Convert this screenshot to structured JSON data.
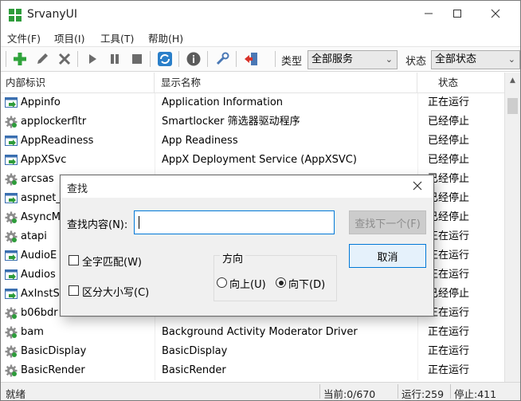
{
  "window": {
    "title": "SrvanyUI"
  },
  "menu": [
    "文件(F)",
    "项目(I)",
    "工具(T)",
    "帮助(H)"
  ],
  "toolbar": {
    "buttons": [
      "add-icon",
      "edit-icon",
      "delete-icon",
      "start-icon",
      "pause-icon",
      "stop-icon",
      "refresh-icon",
      "info-icon",
      "wrench-icon",
      "exit-icon"
    ],
    "type_label": "类型",
    "type_value": "全部服务",
    "status_label": "状态",
    "status_value": "全部状态"
  },
  "table": {
    "columns": [
      "内部标识",
      "显示名称",
      "状态"
    ],
    "rows": [
      {
        "id": "Appinfo",
        "name": "Application Information",
        "status": "正在运行",
        "icon": "window-icon"
      },
      {
        "id": "applockerfltr",
        "name": "Smartlocker 筛选器驱动程序",
        "status": "已经停止",
        "icon": "gear-icon"
      },
      {
        "id": "AppReadiness",
        "name": "App Readiness",
        "status": "已经停止",
        "icon": "window-icon"
      },
      {
        "id": "AppXSvc",
        "name": "AppX Deployment Service (AppXSVC)",
        "status": "已经停止",
        "icon": "window-icon"
      },
      {
        "id": "arcsas",
        "name": "",
        "status": "已经停止",
        "icon": "gear-icon"
      },
      {
        "id": "aspnet_",
        "name": "",
        "status": "已经停止",
        "icon": "window-icon"
      },
      {
        "id": "AsyncM",
        "name": "",
        "status": "已经停止",
        "icon": "gear-icon"
      },
      {
        "id": "atapi",
        "name": "",
        "status": "正在运行",
        "icon": "gear-icon"
      },
      {
        "id": "AudioE",
        "name": "",
        "status": "正在运行",
        "icon": "window-icon"
      },
      {
        "id": "Audios",
        "name": "",
        "status": "正在运行",
        "icon": "window-icon"
      },
      {
        "id": "AxInstS",
        "name": "",
        "status": "已经停止",
        "icon": "window-icon"
      },
      {
        "id": "b06bdr",
        "name": "",
        "status": "正在运行",
        "icon": "gear-icon"
      },
      {
        "id": "bam",
        "name": "Background Activity Moderator Driver",
        "status": "正在运行",
        "icon": "gear-icon"
      },
      {
        "id": "BasicDisplay",
        "name": "BasicDisplay",
        "status": "正在运行",
        "icon": "gear-icon"
      },
      {
        "id": "BasicRender",
        "name": "BasicRender",
        "status": "正在运行",
        "icon": "gear-icon"
      }
    ]
  },
  "statusbar": {
    "ready": "就绪",
    "current": "当前:0/670",
    "running": "运行:259",
    "stopped": "停止:411"
  },
  "find_dialog": {
    "title": "查找",
    "find_label": "查找内容(N):",
    "find_value": "",
    "find_next": "查找下一个(F)",
    "cancel": "取消",
    "whole_word": "全字匹配(W)",
    "match_case": "区分大小写(C)",
    "direction_label": "方向",
    "up": "向上(U)",
    "down": "向下(D)",
    "direction_selected": "down"
  }
}
